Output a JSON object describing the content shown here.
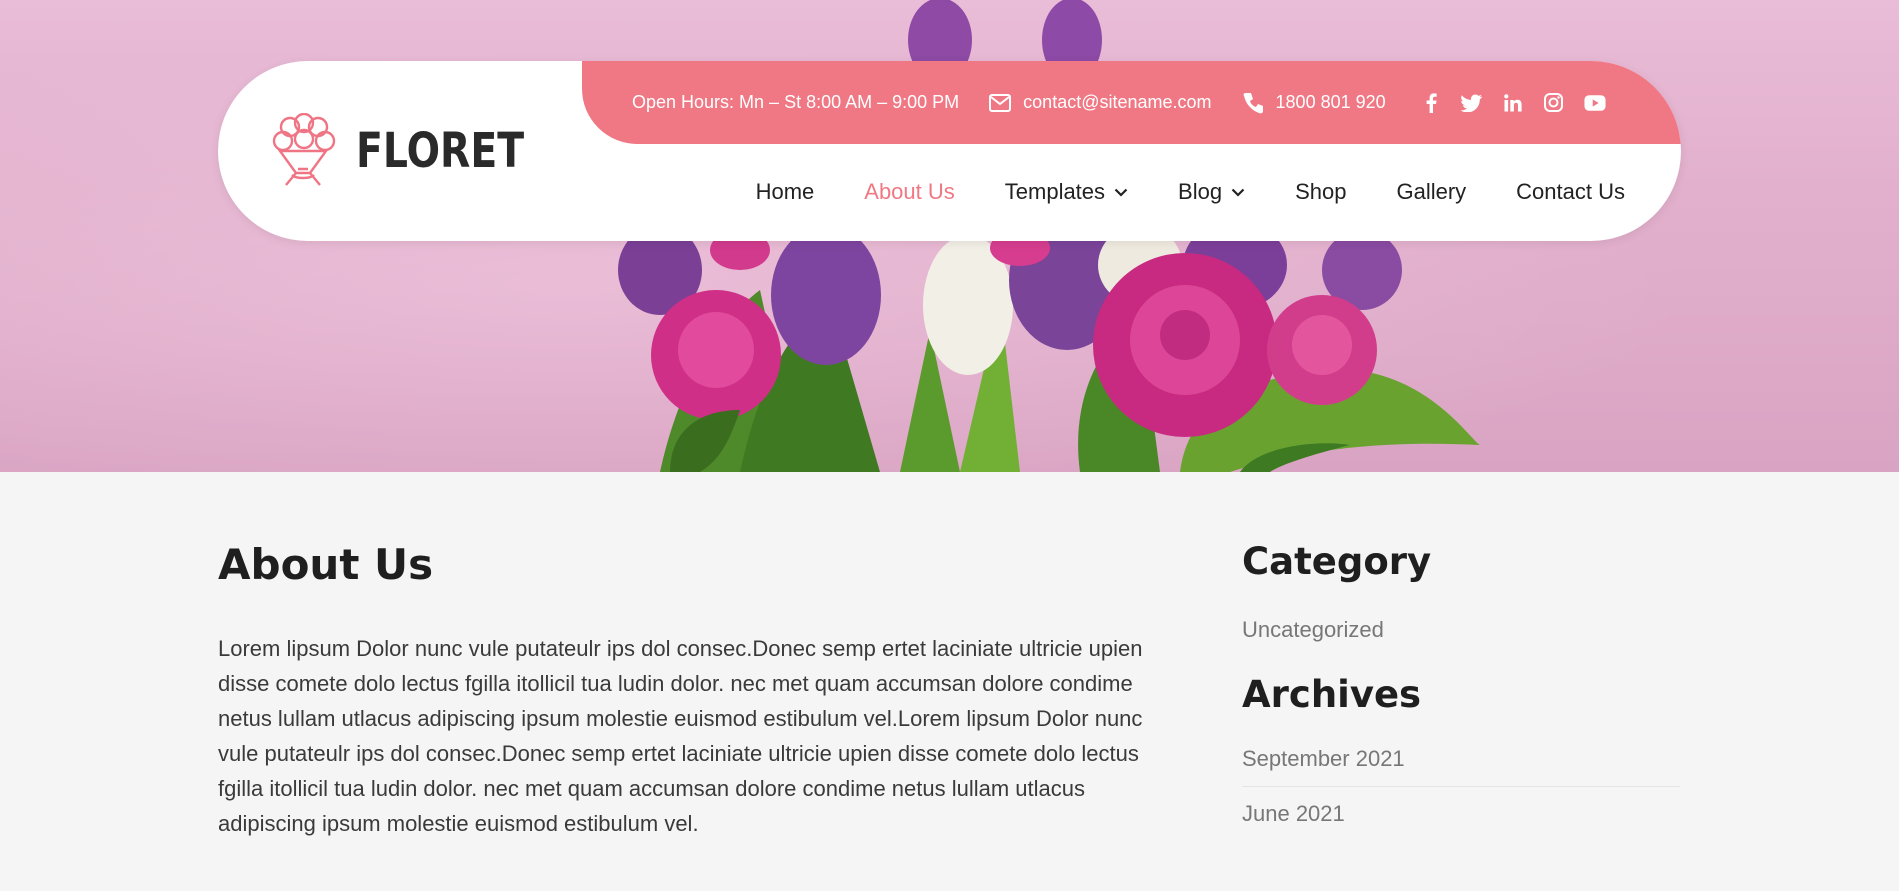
{
  "brand": {
    "name": "FLORET",
    "logo_icon": "bouquet-icon"
  },
  "topbar": {
    "hours": "Open Hours: Mn – St 8:00 AM – 9:00 PM",
    "email": "contact@sitename.com",
    "phone": "1800 801 920",
    "socials": [
      "facebook-icon",
      "twitter-icon",
      "linkedin-icon",
      "instagram-icon",
      "youtube-icon"
    ]
  },
  "nav": {
    "home": "Home",
    "about": "About Us",
    "templates": "Templates",
    "blog": "Blog",
    "shop": "Shop",
    "gallery": "Gallery",
    "contact": "Contact Us"
  },
  "main": {
    "title": "About Us",
    "body": "Lorem lipsum Dolor nunc vule putateulr ips dol consec.Donec semp ertet laciniate ultricie upien disse comete dolo lectus fgilla itollicil tua ludin dolor. nec met quam accumsan dolore condime netus lullam utlacus adipiscing ipsum molestie euismod estibulum vel.Lorem lipsum Dolor nunc vule putateulr ips dol consec.Donec semp ertet laciniate ultricie upien disse comete dolo lectus fgilla itollicil tua ludin dolor. nec met quam accumsan dolore condime netus lullam utlacus adipiscing ipsum molestie euismod estibulum vel."
  },
  "sidebar": {
    "category_title": "Category",
    "categories": [
      "Uncategorized"
    ],
    "archives_title": "Archives",
    "archives": [
      "September 2021",
      "June 2021"
    ]
  },
  "colors": {
    "accent": "#f07884",
    "hero_bg": "#e5b6d2",
    "text_dark": "#222222",
    "muted": "#777777"
  }
}
